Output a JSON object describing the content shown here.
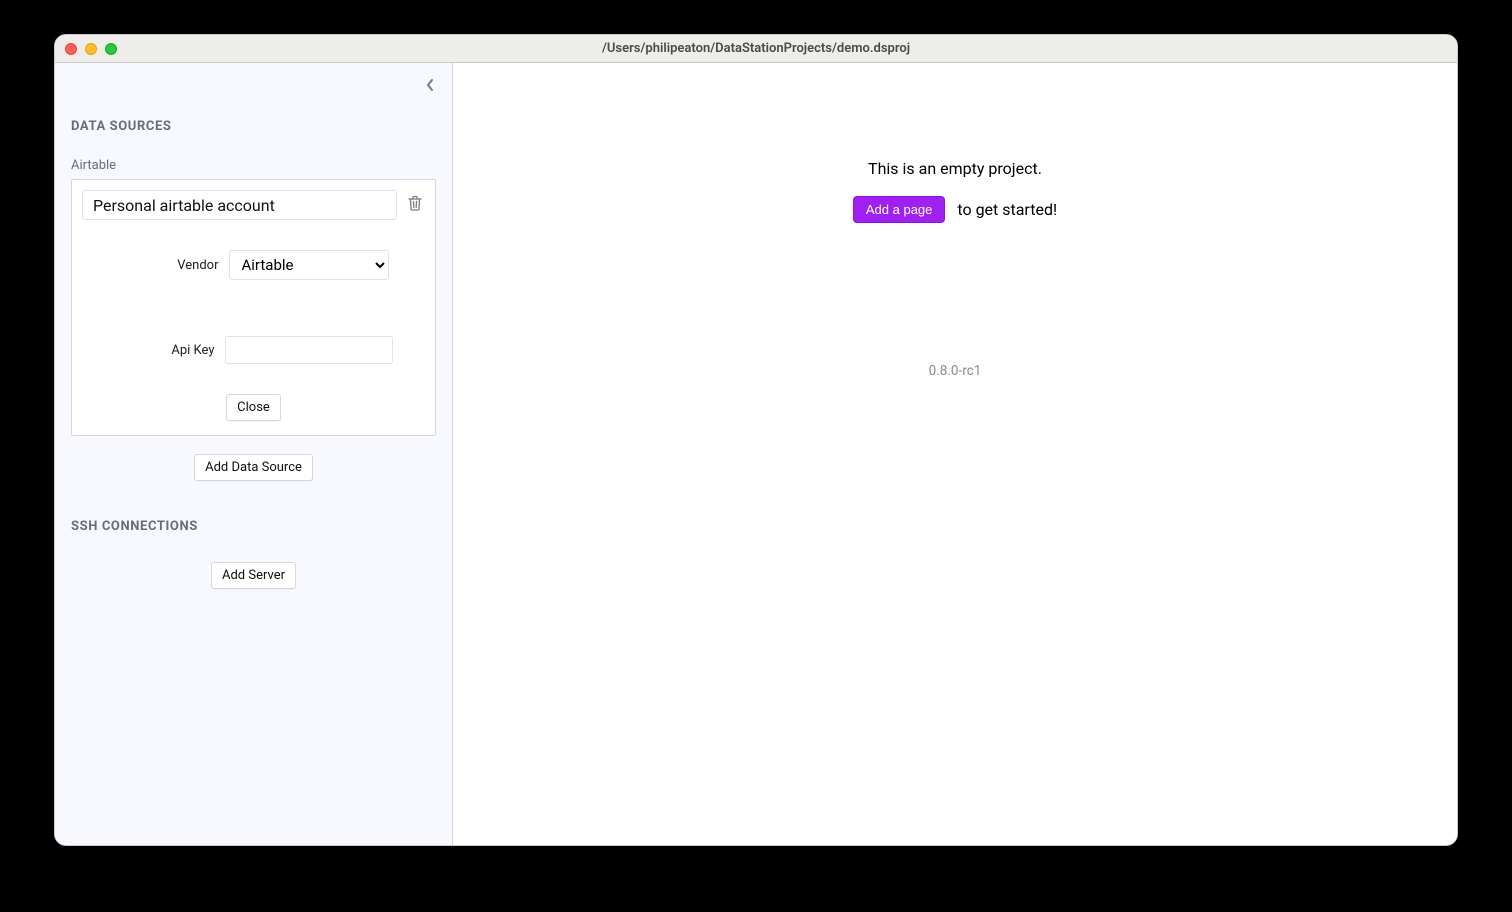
{
  "window": {
    "title": "/Users/philipeaton/DataStationProjects/demo.dsproj"
  },
  "sidebar": {
    "sections": {
      "data_sources_title": "DATA SOURCES",
      "ssh_title": "SSH CONNECTIONS"
    },
    "data_source": {
      "type_label": "Airtable",
      "name_value": "Personal airtable account",
      "vendor_label": "Vendor",
      "vendor_value": "Airtable",
      "api_key_label": "Api Key",
      "api_key_value": "",
      "close_label": "Close"
    },
    "add_data_source_label": "Add Data Source",
    "add_server_label": "Add Server"
  },
  "main": {
    "empty_message": "This is an empty project.",
    "add_page_label": "Add a page",
    "cta_suffix": "to get started!",
    "version": "0.8.0-rc1"
  }
}
